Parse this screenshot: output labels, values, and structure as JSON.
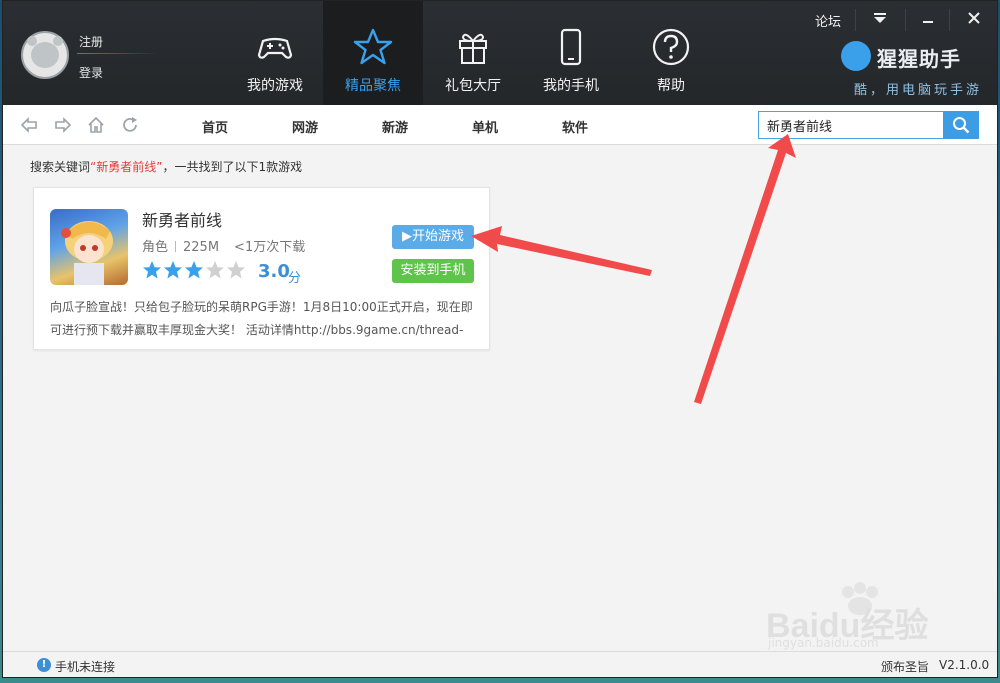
{
  "user": {
    "register": "注册",
    "login": "登录"
  },
  "nav": {
    "tabs": [
      {
        "label": "我的游戏",
        "icon": "gamepad-icon"
      },
      {
        "label": "精品聚焦",
        "icon": "star-icon",
        "active": true
      },
      {
        "label": "礼包大厅",
        "icon": "gift-icon"
      },
      {
        "label": "我的手机",
        "icon": "phone-icon"
      },
      {
        "label": "帮助",
        "icon": "help-icon"
      }
    ]
  },
  "window_controls": {
    "forum": "论坛"
  },
  "brand": {
    "name": "猩猩助手",
    "slogan": "酷，用电脑玩手游"
  },
  "subnav": {
    "items": [
      "首页",
      "网游",
      "新游",
      "单机",
      "软件"
    ]
  },
  "search": {
    "value": "新勇者前线"
  },
  "results": {
    "prefix": "搜索关键词",
    "keyword": "“新勇者前线”",
    "suffix": "，一共找到了以下1款游戏"
  },
  "game": {
    "title": "新勇者前线",
    "category": "角色",
    "size": "225M",
    "downloads": "<1万次下载",
    "rating": "3.0",
    "rating_unit": "分",
    "stars_filled": 3,
    "stars_total": 5,
    "play_label": "开始游戏",
    "install_label": "安装到手机",
    "description": "向瓜子脸宣战！只给包子脸玩的呆萌RPG手游！1月8日10:00正式开启，现在即可进行预下载并赢取丰厚现金大奖！ 活动详情http://bbs.9game.cn/thread-"
  },
  "status": {
    "phone": "手机未连接",
    "announcement": "颁布圣旨",
    "version": "V2.1.0.0"
  },
  "watermark": {
    "text": "Baidu经验",
    "url": "jingyan.baidu.com"
  },
  "colors": {
    "accent": "#3aa0ea",
    "install_green": "#5fc44b",
    "keyword_red": "#e53b3b",
    "arrow_red": "#f04a4a"
  }
}
